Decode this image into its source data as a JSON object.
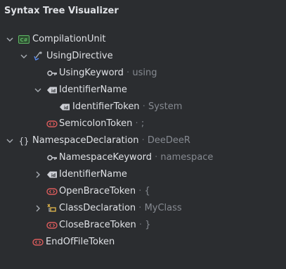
{
  "panel": {
    "title": "Syntax Tree Visualizer"
  },
  "tree": [
    {
      "label": "CompilationUnit",
      "detail": "",
      "icon": "csharp-file-icon",
      "expanded": "expanded"
    },
    {
      "label": "UsingDirective",
      "detail": "",
      "icon": "using-directive-icon",
      "expanded": "expanded"
    },
    {
      "label": "UsingKeyword",
      "detail": "using",
      "icon": "key-icon",
      "expanded": "leaf"
    },
    {
      "label": "IdentifierName",
      "detail": "",
      "icon": "identifier-icon",
      "expanded": "expanded"
    },
    {
      "label": "IdentifierToken",
      "detail": "System",
      "icon": "identifier-icon",
      "expanded": "leaf"
    },
    {
      "label": "SemicolonToken",
      "detail": ";",
      "icon": "token-icon",
      "expanded": "leaf"
    },
    {
      "label": "NamespaceDeclaration",
      "detail": "DeeDeeR",
      "icon": "namespace-icon",
      "expanded": "expanded"
    },
    {
      "label": "NamespaceKeyword",
      "detail": "namespace",
      "icon": "key-icon",
      "expanded": "leaf"
    },
    {
      "label": "IdentifierName",
      "detail": "",
      "icon": "identifier-icon",
      "expanded": "collapsed"
    },
    {
      "label": "OpenBraceToken",
      "detail": "{",
      "icon": "token-icon",
      "expanded": "leaf"
    },
    {
      "label": "ClassDeclaration",
      "detail": "MyClass",
      "icon": "class-declaration-icon",
      "expanded": "collapsed"
    },
    {
      "label": "CloseBraceToken",
      "detail": "}",
      "icon": "token-icon",
      "expanded": "leaf"
    },
    {
      "label": "EndOfFileToken",
      "detail": "",
      "icon": "token-icon",
      "expanded": "leaf"
    }
  ],
  "colors": {
    "background": "#2b2d30",
    "text": "#dfe1e5",
    "detail_text": "#868a91",
    "csharp_icon": "#5fb865",
    "token_icon": "#db5c5c",
    "class_icon": "#e5b94b"
  }
}
